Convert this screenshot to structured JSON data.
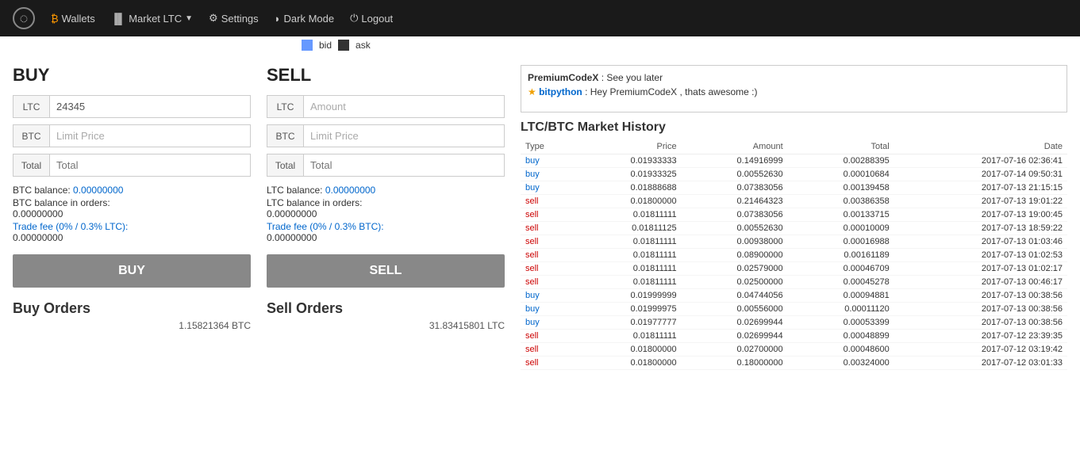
{
  "navbar": {
    "logo_icon": "◌",
    "items": [
      {
        "id": "wallets",
        "icon": "₿",
        "label": "Wallets"
      },
      {
        "id": "market",
        "icon": "▐",
        "label": "Market LTC",
        "dropdown": true
      },
      {
        "id": "settings",
        "icon": "⚙",
        "label": "Settings"
      },
      {
        "id": "darkmode",
        "icon": "◗",
        "label": "Dark Mode"
      },
      {
        "id": "logout",
        "icon": "⏻",
        "label": "Logout"
      }
    ]
  },
  "legend": {
    "bid_label": "bid",
    "ask_label": "ask"
  },
  "buy": {
    "title": "BUY",
    "ltc_prefix": "LTC",
    "ltc_value": "24345",
    "btc_prefix": "BTC",
    "btc_placeholder": "Limit Price",
    "total_label": "Total",
    "total_placeholder": "Total",
    "btc_balance_label": "BTC balance:",
    "btc_balance_value": "0.00000000",
    "btc_in_orders_label": "BTC balance in orders:",
    "btc_in_orders_value": "0.00000000",
    "trade_fee_label": "Trade fee (0% / 0.3% LTC):",
    "trade_fee_value": "0.00000000",
    "button_label": "BUY"
  },
  "sell": {
    "title": "SELL",
    "ltc_prefix": "LTC",
    "ltc_placeholder": "Amount",
    "btc_prefix": "BTC",
    "btc_placeholder": "Limit Price",
    "total_label": "Total",
    "total_placeholder": "Total",
    "ltc_balance_label": "LTC balance:",
    "ltc_balance_value": "0.00000000",
    "ltc_in_orders_label": "LTC balance in orders:",
    "ltc_in_orders_value": "0.00000000",
    "trade_fee_label": "Trade fee (0% / 0.3% BTC):",
    "trade_fee_value": "0.00000000",
    "button_label": "SELL"
  },
  "buy_orders": {
    "title": "Buy Orders",
    "total": "1.15821364 BTC"
  },
  "sell_orders": {
    "title": "Sell Orders",
    "total": "31.83415801 LTC"
  },
  "chat": {
    "messages": [
      {
        "user": "PremiumCodeX",
        "separator": " : ",
        "text": "See you later"
      },
      {
        "user": "bitpython",
        "separator": " : ",
        "text": "Hey PremiumCodeX , thats awesome :)"
      }
    ]
  },
  "market_history": {
    "title": "LTC/BTC Market History",
    "columns": [
      "Type",
      "Price",
      "Amount",
      "Total",
      "Date"
    ],
    "rows": [
      {
        "type": "buy",
        "price": "0.01933333",
        "amount": "0.14916999",
        "total": "0.00288395",
        "date": "2017-07-16 02:36:41"
      },
      {
        "type": "buy",
        "price": "0.01933325",
        "amount": "0.00552630",
        "total": "0.00010684",
        "date": "2017-07-14 09:50:31"
      },
      {
        "type": "buy",
        "price": "0.01888688",
        "amount": "0.07383056",
        "total": "0.00139458",
        "date": "2017-07-13 21:15:15"
      },
      {
        "type": "sell",
        "price": "0.01800000",
        "amount": "0.21464323",
        "total": "0.00386358",
        "date": "2017-07-13 19:01:22"
      },
      {
        "type": "sell",
        "price": "0.01811111",
        "amount": "0.07383056",
        "total": "0.00133715",
        "date": "2017-07-13 19:00:45"
      },
      {
        "type": "sell",
        "price": "0.01811125",
        "amount": "0.00552630",
        "total": "0.00010009",
        "date": "2017-07-13 18:59:22"
      },
      {
        "type": "sell",
        "price": "0.01811111",
        "amount": "0.00938000",
        "total": "0.00016988",
        "date": "2017-07-13 01:03:46"
      },
      {
        "type": "sell",
        "price": "0.01811111",
        "amount": "0.08900000",
        "total": "0.00161189",
        "date": "2017-07-13 01:02:53"
      },
      {
        "type": "sell",
        "price": "0.01811111",
        "amount": "0.02579000",
        "total": "0.00046709",
        "date": "2017-07-13 01:02:17"
      },
      {
        "type": "sell",
        "price": "0.01811111",
        "amount": "0.02500000",
        "total": "0.00045278",
        "date": "2017-07-13 00:46:17"
      },
      {
        "type": "buy",
        "price": "0.01999999",
        "amount": "0.04744056",
        "total": "0.00094881",
        "date": "2017-07-13 00:38:56"
      },
      {
        "type": "buy",
        "price": "0.01999975",
        "amount": "0.00556000",
        "total": "0.00011120",
        "date": "2017-07-13 00:38:56"
      },
      {
        "type": "buy",
        "price": "0.01977777",
        "amount": "0.02699944",
        "total": "0.00053399",
        "date": "2017-07-13 00:38:56"
      },
      {
        "type": "sell",
        "price": "0.01811111",
        "amount": "0.02699944",
        "total": "0.00048899",
        "date": "2017-07-12 23:39:35"
      },
      {
        "type": "sell",
        "price": "0.01800000",
        "amount": "0.02700000",
        "total": "0.00048600",
        "date": "2017-07-12 03:19:42"
      },
      {
        "type": "sell",
        "price": "0.01800000",
        "amount": "0.18000000",
        "total": "0.00324000",
        "date": "2017-07-12 03:01:33"
      }
    ]
  }
}
